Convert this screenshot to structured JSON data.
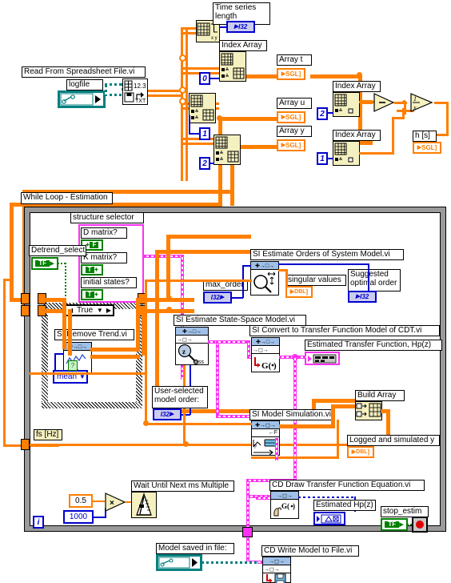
{
  "diagram": {
    "title": "While Loop - Estimation",
    "labels": {
      "read_spreadsheet": "Read From Spreadsheet File.vi",
      "logfile": "logfile",
      "time_series_length": "Time series\nlength",
      "index_array": "Index Array",
      "array_t": "Array t",
      "array_u": "Array u",
      "array_y": "Array y",
      "h_s": "h [s]",
      "structure_selector": "structure selector",
      "d_matrix": "D matrix?",
      "k_matrix": "K matrix?",
      "initial_states": "initial states?",
      "detrend_select": "Detrend_select",
      "si_remove_trend": "SI Remove Trend.vi",
      "case_true": "True",
      "mean": "mean",
      "fs_hz": "fs [Hz]",
      "si_estimate_orders": "SI Estimate Orders of System Model.vi",
      "max_order": "max_order",
      "singular_values": "singular values",
      "suggested_optimal_order": "Suggested\noptimal order",
      "si_estimate_ss": "SI Estimate State-Space Model.vi",
      "si_convert_tf": "SI Convert to Transfer Function Model of CDT.vi",
      "estimated_tf": "Estimated Transfer Function, Hp(z)",
      "user_selected_model_order": "User-selected\nmodel order:",
      "si_model_simulation": "SI Model Simulation.vi",
      "build_array": "Build Array",
      "logged_and_simulated_y": "Logged and simulated y",
      "wait_until_next_ms": "Wait Until Next ms Multiple",
      "cd_draw_tf_eq": "CD Draw Transfer Function Equation.vi",
      "estimated_hp_z": "Estimated Hp(z)",
      "stop_estim": "stop_estim",
      "model_saved_in_file": "Model saved in file:",
      "cd_write_model": "CD Write Model to File.vi"
    },
    "constants": {
      "idx_0": "0",
      "idx_1a": "1",
      "idx_2a": "2",
      "idx_2b": "2",
      "idx_1b": "1",
      "half": "0.5",
      "thousand": "1000",
      "loop_i": "i"
    },
    "terminals": {
      "i32": "I32",
      "sgl": "SGL",
      "dbl": "DBL",
      "tf_true": "T",
      "tf_false": "F",
      "tf": "TF"
    },
    "node_glyphs": {
      "array_size": "array-size-icon",
      "index_array": "index-array-icon",
      "read_spreadsheet": "read-spreadsheet-file-icon",
      "file_path_control": "file-path-control-icon",
      "subtract": "subtract-operator-icon",
      "reciprocal": "reciprocal-operator-icon",
      "multiply": "multiply-operator-icon",
      "metronome": "wait-ms-icon",
      "build_array": "build-array-icon",
      "stop_button": "stop-button-icon"
    },
    "colors": {
      "wire_orange": "#ff7f00",
      "wire_blue": "#0000cd",
      "wire_magenta": "#ff2ff2",
      "wire_teal": "#00807f",
      "wire_green": "#008000",
      "loop_border": "#9a9a9a",
      "node_fill": "#f5f0c0",
      "conn_pane": "#9fc0e8"
    }
  }
}
